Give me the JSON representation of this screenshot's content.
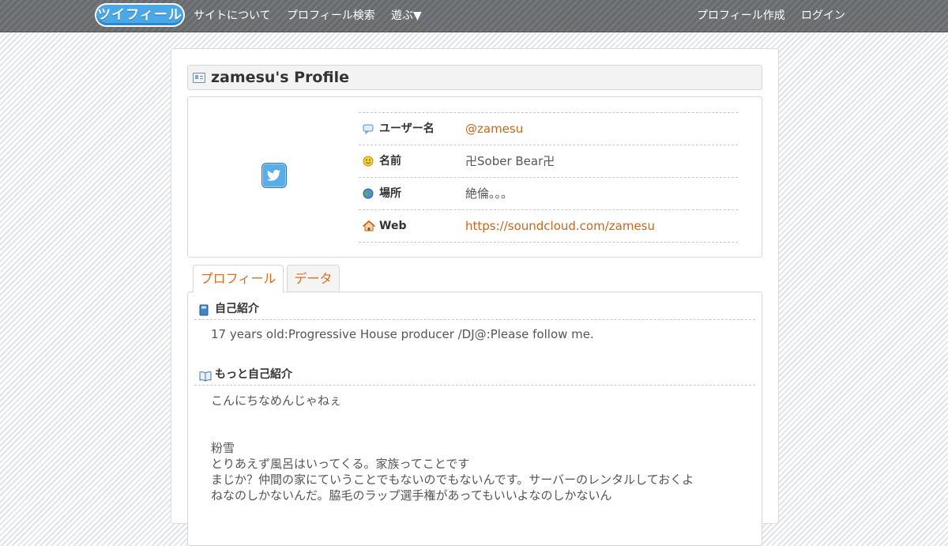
{
  "nav": {
    "logo": "ツイフィール",
    "about": "サイトについて",
    "search": "プロフィール検索",
    "play": "遊ぶ▼",
    "create": "プロフィール作成",
    "login": "ログイン"
  },
  "profile": {
    "title": "zamesu's Profile",
    "rows": [
      {
        "label": "ユーザー名",
        "value": "@zamesu",
        "icon": "speech-bubble-icon"
      },
      {
        "label": "名前",
        "value": "卍Sober Bear卍",
        "icon": "smiley-icon"
      },
      {
        "label": "場所",
        "value": "絶倫。。。",
        "icon": "globe-icon"
      },
      {
        "label": "Web",
        "value": "https://soundcloud.com/zamesu",
        "icon": "home-icon"
      }
    ]
  },
  "tabs": {
    "profile": "プロフィール",
    "data": "データ"
  },
  "sections": {
    "intro_title": "自己紹介",
    "intro_text": "17 years old:Progressive House producer /DJ@:Please follow me.",
    "more_title": "もっと自己紹介",
    "more_lines": [
      "こんにちなめんじゃねぇ",
      "粉雪",
      "とりあえず風呂はいってくる。家族ってことです",
      "まじか？仲間の家にていうことでもないのでもないんです。サーバーのレンタルしておくよ",
      "ねなのしかないんだ。脇毛のラップ選手権があってもいいよなのしかないん"
    ]
  },
  "colors": {
    "accent": "#c8661e",
    "navbar": "#6b6e70",
    "twitter": "#5aaee8"
  }
}
